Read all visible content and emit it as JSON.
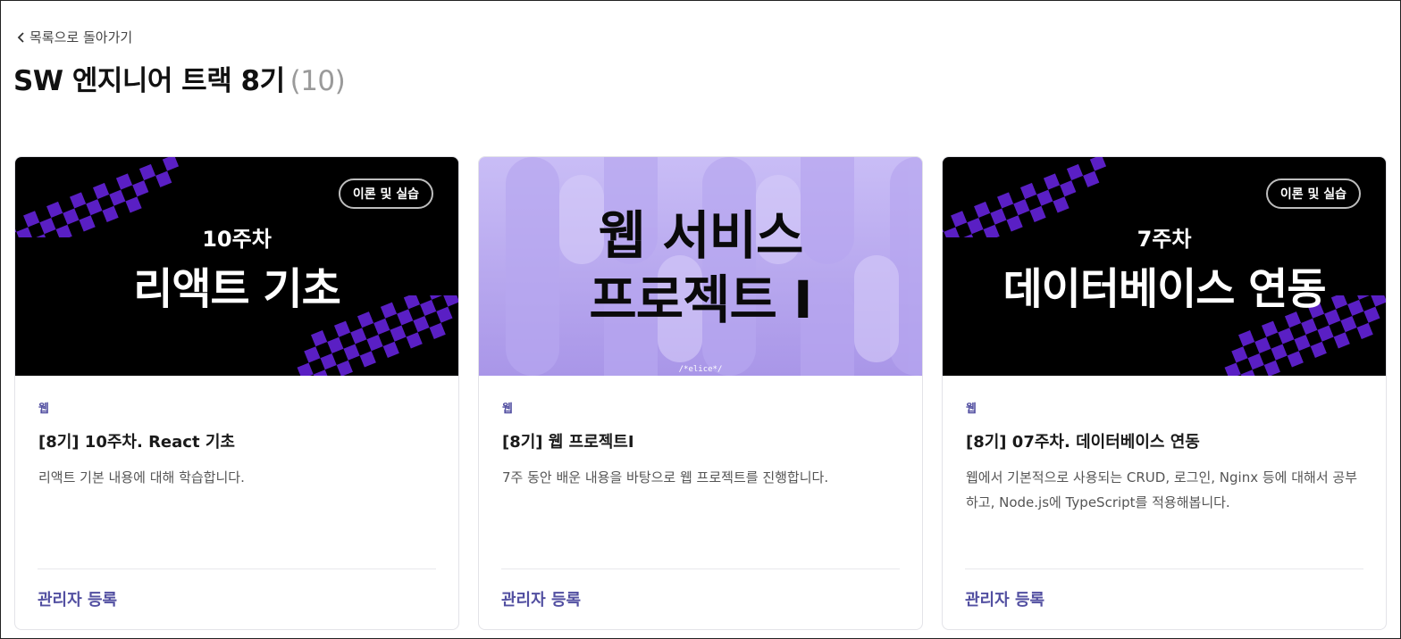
{
  "nav": {
    "back_label": "목록으로 돌아가기"
  },
  "header": {
    "title": "SW 엔지니어 트랙 8기",
    "count": "(10)"
  },
  "cards": [
    {
      "thumb": {
        "badge": "이론 및 실습",
        "week": "10주차",
        "headline": "리액트 기초"
      },
      "category": "웹",
      "title": "[8기] 10주차. React 기초",
      "description": "리액트 기본 내용에 대해 학습합니다.",
      "action": "관리자 등록"
    },
    {
      "thumb": {
        "headline_line1": "웹 서비스",
        "headline_line2": "프로젝트 I",
        "watermark": "/*elice*/"
      },
      "category": "웹",
      "title": "[8기] 웹 프로젝트I",
      "description": "7주 동안 배운 내용을 바탕으로 웹 프로젝트를 진행합니다.",
      "action": "관리자 등록"
    },
    {
      "thumb": {
        "badge": "이론 및 실습",
        "week": "7주차",
        "headline": "데이터베이스 연동"
      },
      "category": "웹",
      "title": "[8기] 07주차. 데이터베이스 연동",
      "description": "웹에서 기본적으로 사용되는 CRUD, 로그인, Nginx 등에 대해서 공부하고, Node.js에 TypeScript를 적용해봅니다.",
      "action": "관리자 등록"
    }
  ],
  "colors": {
    "accent": "#524fa1",
    "checker": "#5a1fc4"
  }
}
